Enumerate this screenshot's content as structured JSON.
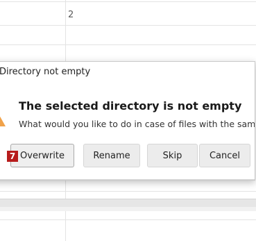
{
  "spreadsheet": {
    "visible_cell_value": "2"
  },
  "dialog": {
    "title": "Directory not empty",
    "heading": "The selected directory is not empty",
    "message": "What would you like to do in case of files with the same name?",
    "icon": "warning-icon",
    "buttons": {
      "overwrite": "Overwrite",
      "rename": "Rename",
      "skip": "Skip",
      "cancel": "Cancel"
    },
    "shortcut_badge": "7"
  },
  "colors": {
    "warning": "#f0a24a",
    "badge": "#b71c1c"
  }
}
